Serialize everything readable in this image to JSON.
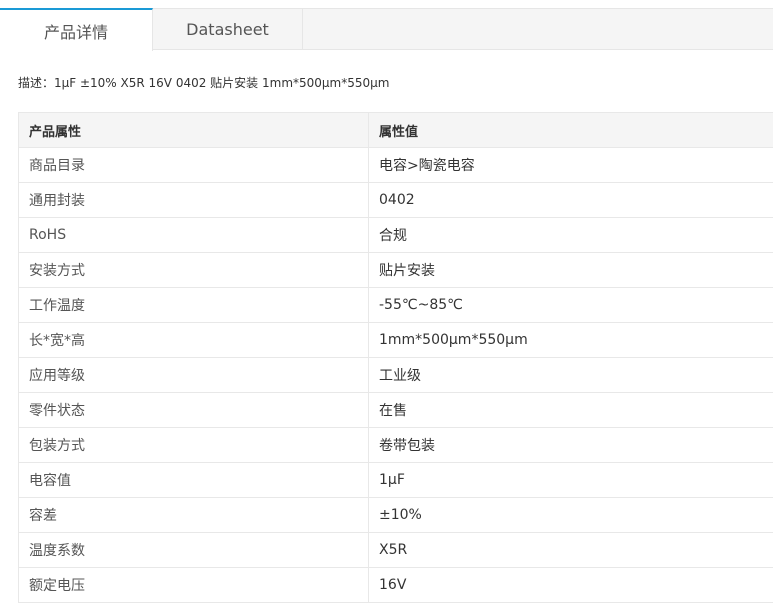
{
  "tabs": [
    {
      "label": "产品详情",
      "active": true
    },
    {
      "label": "Datasheet",
      "active": false
    }
  ],
  "description": "描述：1μF ±10% X5R 16V 0402 贴片安装 1mm*500μm*550μm",
  "table": {
    "headers": [
      "产品属性",
      "属性值"
    ],
    "rows": [
      {
        "attr": "商品目录",
        "value": "电容>陶瓷电容"
      },
      {
        "attr": "通用封装",
        "value": "0402"
      },
      {
        "attr": "RoHS",
        "value": "合规"
      },
      {
        "attr": "安装方式",
        "value": "贴片安装"
      },
      {
        "attr": "工作温度",
        "value": "-55℃~85℃"
      },
      {
        "attr": "长*宽*高",
        "value": "1mm*500μm*550μm"
      },
      {
        "attr": "应用等级",
        "value": "工业级"
      },
      {
        "attr": "零件状态",
        "value": "在售"
      },
      {
        "attr": "包装方式",
        "value": "卷带包装"
      },
      {
        "attr": "电容值",
        "value": "1μF"
      },
      {
        "attr": "容差",
        "value": "±10%"
      },
      {
        "attr": "温度系数",
        "value": "X5R"
      },
      {
        "attr": "额定电压",
        "value": "16V"
      }
    ]
  },
  "colors": {
    "accent": "#1a9ad6",
    "header_bg": "#f5f5f5",
    "border": "#e8e8e8"
  }
}
